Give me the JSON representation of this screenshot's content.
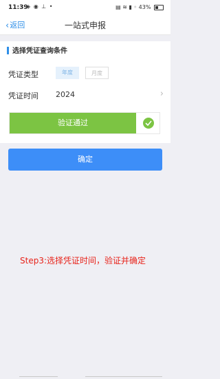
{
  "status_bar": {
    "time": "11:39",
    "left_icons": "◈ ◉ ⊥ •",
    "right_icons": "▤ ≋ ▮ ◦",
    "battery": "43%"
  },
  "nav": {
    "back_label": "返回",
    "title": "一站式申报"
  },
  "form": {
    "section_title": "选择凭证查询条件",
    "type_label": "凭证类型",
    "type_options": [
      "年度",
      "月度"
    ],
    "time_label": "凭证时间",
    "time_value": "2024",
    "verify_label": "验证通过",
    "confirm_label": "确定"
  },
  "annotation": "Step3:选择凭证时间，验证并确定",
  "colors": {
    "accent_blue": "#3d8ef8",
    "success_green": "#7cc443",
    "annotation_red": "#e8241b"
  }
}
